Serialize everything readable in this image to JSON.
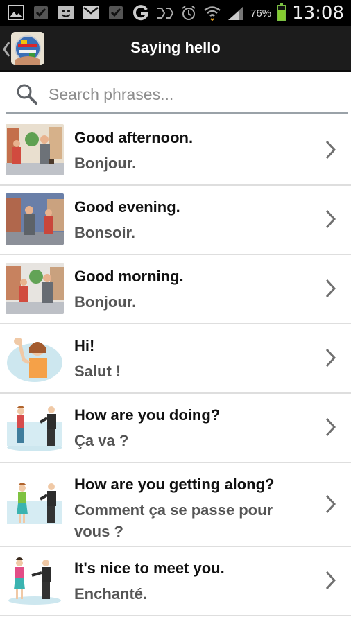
{
  "status_bar": {
    "battery_text": "76%",
    "battery_level": 0.76,
    "time": "13:08",
    "icons": [
      "image-icon",
      "check-icon",
      "face-icon",
      "mail-icon",
      "check-icon",
      "google-icon",
      "network-icon",
      "alarm-icon",
      "wifi-icon",
      "signal-icon",
      "battery-icon"
    ]
  },
  "header": {
    "title": "Saying hello",
    "logo": "globe-icon",
    "back": "back-chevron-icon"
  },
  "search": {
    "placeholder": "Search phrases..."
  },
  "colors": {
    "header_bg": "#1c1c1c",
    "translation_text": "#555555",
    "divider": "#dedede",
    "battery": "#84cc2f"
  },
  "phrases": [
    {
      "phrase": "Good afternoon.",
      "translation_lines": [
        "Bonjour."
      ]
    },
    {
      "phrase": "Good evening.",
      "translation_lines": [
        "Bonsoir."
      ]
    },
    {
      "phrase": "Good morning.",
      "translation_lines": [
        "Bonjour."
      ]
    },
    {
      "phrase": "Hi!",
      "translation_lines": [
        "Salut !"
      ]
    },
    {
      "phrase": "How are you doing?",
      "translation_lines": [
        "Ça va ?"
      ]
    },
    {
      "phrase": "How are you getting along?",
      "translation_lines": [
        "Comment ça se passe pour",
        "vous ?"
      ]
    },
    {
      "phrase": "It's nice to meet you.",
      "translation_lines": [
        "Enchanté."
      ]
    }
  ]
}
